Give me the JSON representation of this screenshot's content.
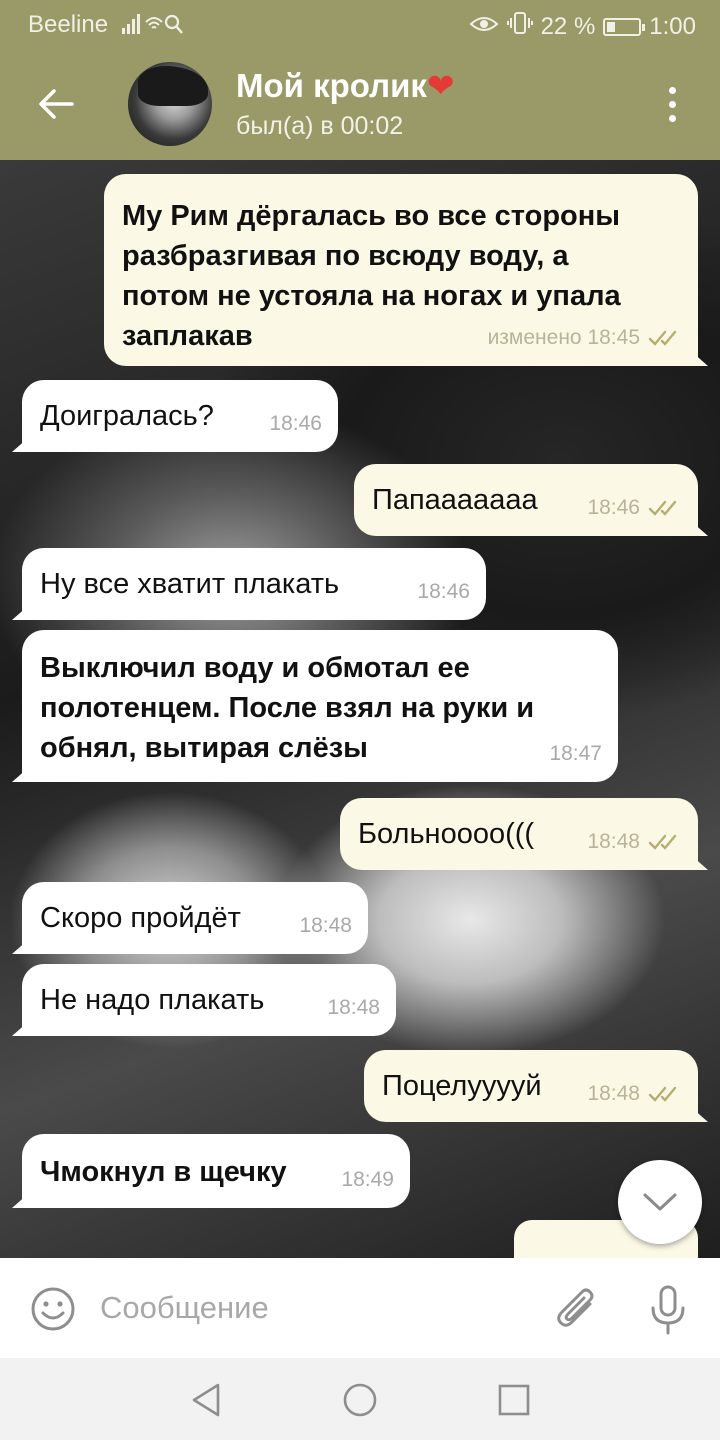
{
  "status_bar": {
    "carrier": "Beeline",
    "battery_percent": "22 %",
    "battery_level": 0.22,
    "time": "1:00"
  },
  "header": {
    "back_icon": "arrow-left-icon",
    "avatar_icon": "contact-avatar",
    "title": "Мой кролик",
    "title_emoji": "❤",
    "status": "был(а) в 00:02",
    "menu_icon": "kebab-menu-icon"
  },
  "messages": [
    {
      "direction": "out",
      "text": "Му Рим дёргалась во все стороны\nразбразгивая по всюду воду, а\nпотом не устояла на ногах и упала\nзаплакав",
      "bold": true,
      "time": "изменено 18:45",
      "read": true
    },
    {
      "direction": "in",
      "text": "Доигралась?",
      "bold": false,
      "time": "18:46"
    },
    {
      "direction": "out",
      "text": "Папааааааа",
      "bold": false,
      "time": "18:46",
      "read": true
    },
    {
      "direction": "in",
      "text": "Ну все хватит плакать",
      "bold": false,
      "time": "18:46"
    },
    {
      "direction": "in",
      "text": "Выключил воду и обмотал ее\nполотенцем. После взял на руки и\nобнял, вытирая слёзы",
      "bold": true,
      "time": "18:47"
    },
    {
      "direction": "out",
      "text": "Больнoooo(((",
      "bold": false,
      "time": "18:48",
      "read": true
    },
    {
      "direction": "in",
      "text": "Скоро пройдёт",
      "bold": false,
      "time": "18:48"
    },
    {
      "direction": "in",
      "text": "Не надо плакать",
      "bold": false,
      "time": "18:48"
    },
    {
      "direction": "out",
      "text": "Поцелууууй",
      "bold": false,
      "time": "18:48",
      "read": true
    },
    {
      "direction": "in",
      "text": "Чмокнул в щечку",
      "bold": true,
      "time": "18:49"
    }
  ],
  "scroll_down_icon": "chevron-down-icon",
  "composer": {
    "emoji_icon": "smile-icon",
    "placeholder": "Сообщение",
    "attach_icon": "paperclip-icon",
    "mic_icon": "microphone-icon"
  },
  "nav": {
    "back_icon": "triangle-back-icon",
    "home_icon": "circle-home-icon",
    "recents_icon": "square-recents-icon"
  },
  "colors": {
    "header_bg": "#9a9a68",
    "incoming_bubble": "#ffffff",
    "outgoing_bubble": "#fcf8e6",
    "read_check": "#b5ae70"
  }
}
